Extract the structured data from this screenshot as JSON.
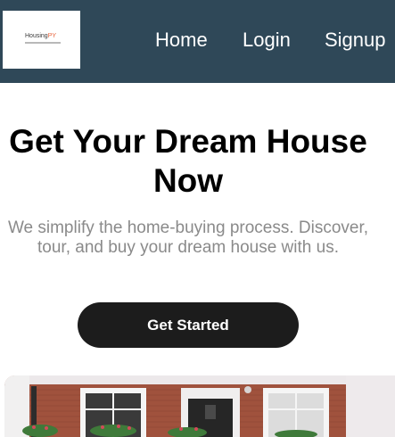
{
  "brand": {
    "name_main": "Housing",
    "name_accent": "PY"
  },
  "nav": {
    "home": "Home",
    "login": "Login",
    "signup": "Signup"
  },
  "hero": {
    "title": "Get Your Dream House Now",
    "subtitle": "We simplify the home-buying process. Discover, tour, and buy your dream house with us.",
    "cta": "Get Started"
  },
  "colors": {
    "navbar": "#2f4858",
    "button": "#1c1c1c",
    "subtitle": "#8a8a8a"
  },
  "icons": {
    "logo": "housing-py-logo",
    "photo": "brick-house-photo"
  }
}
